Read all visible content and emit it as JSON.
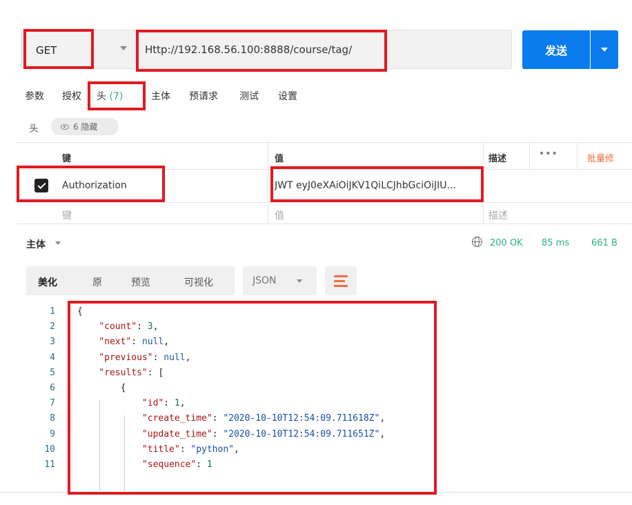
{
  "request": {
    "method": "GET",
    "url": "Http://192.168.56.100:8888/course/tag/",
    "send_label": "发送"
  },
  "tabs": [
    {
      "label": "参数"
    },
    {
      "label": "授权"
    },
    {
      "label": "头",
      "count": "(7)"
    },
    {
      "label": "主体"
    },
    {
      "label": "预请求"
    },
    {
      "label": "测试"
    },
    {
      "label": "设置"
    }
  ],
  "headers_section": {
    "label": "头",
    "hidden_label": "6 隐藏"
  },
  "headers_table": {
    "columns": {
      "key": "键",
      "value": "值",
      "description": "描述",
      "more": "•••",
      "bulk_edit": "批量修"
    },
    "rows": [
      {
        "checked": true,
        "key": "Authorization",
        "value": "JWT eyJ0eXAiOiJKV1QiLCJhbGciOiJIU..."
      }
    ],
    "placeholders": {
      "key": "键",
      "value": "值",
      "description": "描述"
    }
  },
  "response": {
    "body_label": "主体",
    "status": "200 OK",
    "time": "85 ms",
    "size": "661 B",
    "view_buttons": [
      "美化",
      "原",
      "预览",
      "可视化"
    ],
    "format": "JSON",
    "code_lines": [
      {
        "n": "1",
        "text": "{"
      },
      {
        "n": "2",
        "text": "    \"count\": 3,"
      },
      {
        "n": "3",
        "text": "    \"next\": null,"
      },
      {
        "n": "4",
        "text": "    \"previous\": null,"
      },
      {
        "n": "5",
        "text": "    \"results\": ["
      },
      {
        "n": "6",
        "text": "        {"
      },
      {
        "n": "7",
        "text": "            \"id\": 1,"
      },
      {
        "n": "8",
        "text": "            \"create_time\": \"2020-10-10T12:54:09.711618Z\","
      },
      {
        "n": "9",
        "text": "            \"update_time\": \"2020-10-10T12:54:09.711651Z\","
      },
      {
        "n": "10",
        "text": "            \"title\": \"python\","
      },
      {
        "n": "11",
        "text": "            \"sequence\": 1"
      }
    ]
  },
  "colors": {
    "accent": "#097bed",
    "highlight_box": "#e21921",
    "status_ok": "#26b47f",
    "bulk_edit": "#f26b3a"
  }
}
